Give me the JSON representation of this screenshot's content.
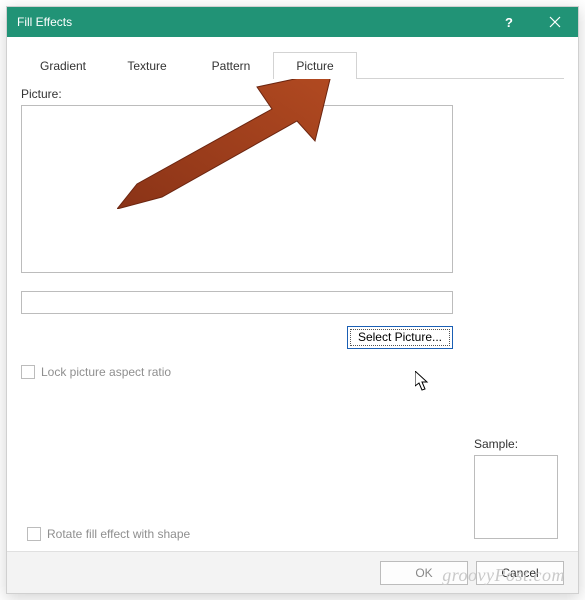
{
  "window": {
    "title": "Fill Effects"
  },
  "tabs": {
    "items": [
      {
        "label": "Gradient"
      },
      {
        "label": "Texture"
      },
      {
        "label": "Pattern"
      },
      {
        "label": "Picture"
      }
    ],
    "active_index": 3
  },
  "picture_panel": {
    "section_label": "Picture:",
    "select_button": "Select Picture...",
    "lock_aspect_label": "Lock picture aspect ratio",
    "lock_aspect_checked": false
  },
  "sample": {
    "label": "Sample:"
  },
  "rotate": {
    "label": "Rotate fill effect with shape",
    "checked": false
  },
  "footer": {
    "ok": "OK",
    "cancel": "Cancel"
  },
  "watermark": "groovyPost.com"
}
